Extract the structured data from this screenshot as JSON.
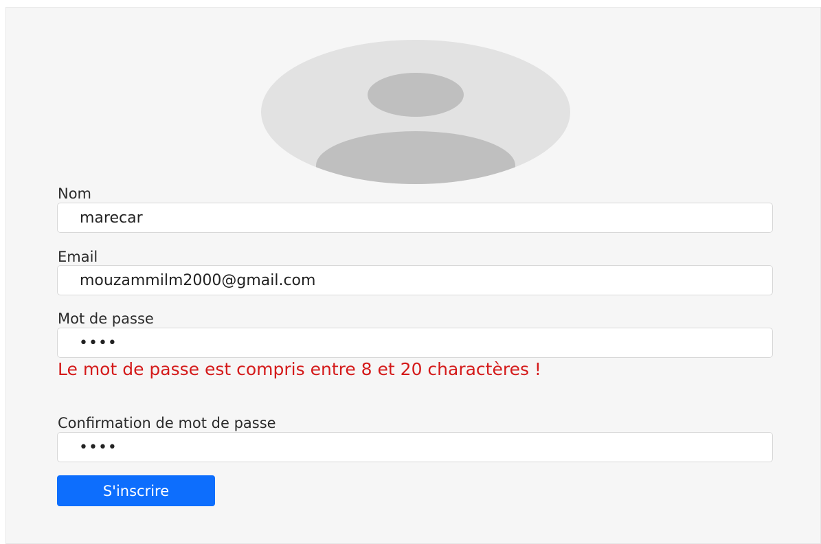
{
  "form": {
    "name_label": "Nom",
    "name_value": "marecar",
    "email_label": "Email",
    "email_value": "mouzammilm2000@gmail.com",
    "password_label": "Mot de passe",
    "password_value": "1234",
    "password_error": "Le mot de passe est compris entre 8 et 20 charactères !",
    "confirm_label": "Confirmation de mot de passe",
    "confirm_value": "1234",
    "submit_label": "S'inscrire"
  },
  "avatar": {
    "icon": "user-placeholder-icon",
    "bg_color": "#e2e2e2",
    "fg_color": "#bfbfbf"
  },
  "colors": {
    "accent": "#0d6efd",
    "error": "#d41a1a"
  }
}
